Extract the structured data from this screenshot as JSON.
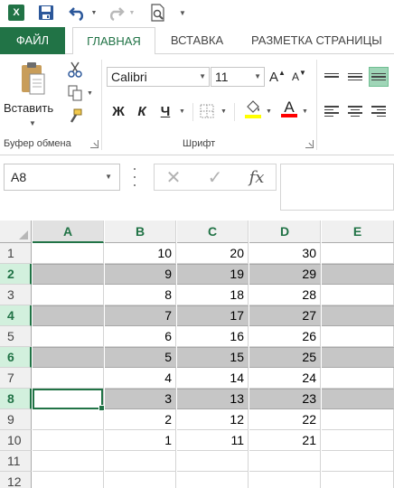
{
  "qat": {
    "app_icon": "excel-logo-icon",
    "app_letter": "X",
    "buttons": [
      "save-icon",
      "undo-icon",
      "redo-icon",
      "print-preview-icon",
      "customize-qat-icon"
    ]
  },
  "tabs": [
    {
      "label": "ФАЙЛ"
    },
    {
      "label": "ГЛАВНАЯ"
    },
    {
      "label": "ВСТАВКА"
    },
    {
      "label": "РАЗМЕТКА СТРАНИЦЫ"
    }
  ],
  "ribbon": {
    "clipboard": {
      "paste_label": "Вставить",
      "group_label": "Буфер обмена"
    },
    "font": {
      "font_name": "Calibri",
      "font_size": "11",
      "bold": "Ж",
      "italic": "К",
      "underline": "Ч",
      "font_color_letter": "A",
      "grow_letter": "A",
      "shrink_letter": "A",
      "group_label": "Шрифт",
      "fill_color": "#FFFF00",
      "font_color": "#FF0000"
    }
  },
  "formula_bar": {
    "name_box": "A8",
    "fx_label": "fx",
    "cancel_glyph": "✕",
    "enter_glyph": "✓",
    "formula_value": ""
  },
  "sheet": {
    "columns": [
      "A",
      "B",
      "C",
      "D",
      "E"
    ],
    "selected_column": "A",
    "active_cell": "A8",
    "rows": [
      {
        "num": "1",
        "selected": false,
        "cells": [
          "",
          "10",
          "20",
          "30",
          ""
        ]
      },
      {
        "num": "2",
        "selected": true,
        "cells": [
          "",
          "9",
          "19",
          "29",
          ""
        ]
      },
      {
        "num": "3",
        "selected": false,
        "cells": [
          "",
          "8",
          "18",
          "28",
          ""
        ]
      },
      {
        "num": "4",
        "selected": true,
        "cells": [
          "",
          "7",
          "17",
          "27",
          ""
        ]
      },
      {
        "num": "5",
        "selected": false,
        "cells": [
          "",
          "6",
          "16",
          "26",
          ""
        ]
      },
      {
        "num": "6",
        "selected": true,
        "cells": [
          "",
          "5",
          "15",
          "25",
          ""
        ]
      },
      {
        "num": "7",
        "selected": false,
        "cells": [
          "",
          "4",
          "14",
          "24",
          ""
        ]
      },
      {
        "num": "8",
        "selected": true,
        "cells": [
          "",
          "3",
          "13",
          "23",
          ""
        ]
      },
      {
        "num": "9",
        "selected": false,
        "cells": [
          "",
          "2",
          "12",
          "22",
          ""
        ]
      },
      {
        "num": "10",
        "selected": false,
        "cells": [
          "",
          "1",
          "11",
          "21",
          ""
        ]
      },
      {
        "num": "11",
        "selected": false,
        "cells": [
          "",
          "",
          "",
          "",
          ""
        ]
      },
      {
        "num": "12",
        "selected": false,
        "cells": [
          "",
          "",
          "",
          "",
          ""
        ]
      }
    ]
  },
  "colors": {
    "accent": "#217346",
    "selected_row_fill": "#C6C6C6",
    "selected_header_fill": "#D2F0DD"
  }
}
